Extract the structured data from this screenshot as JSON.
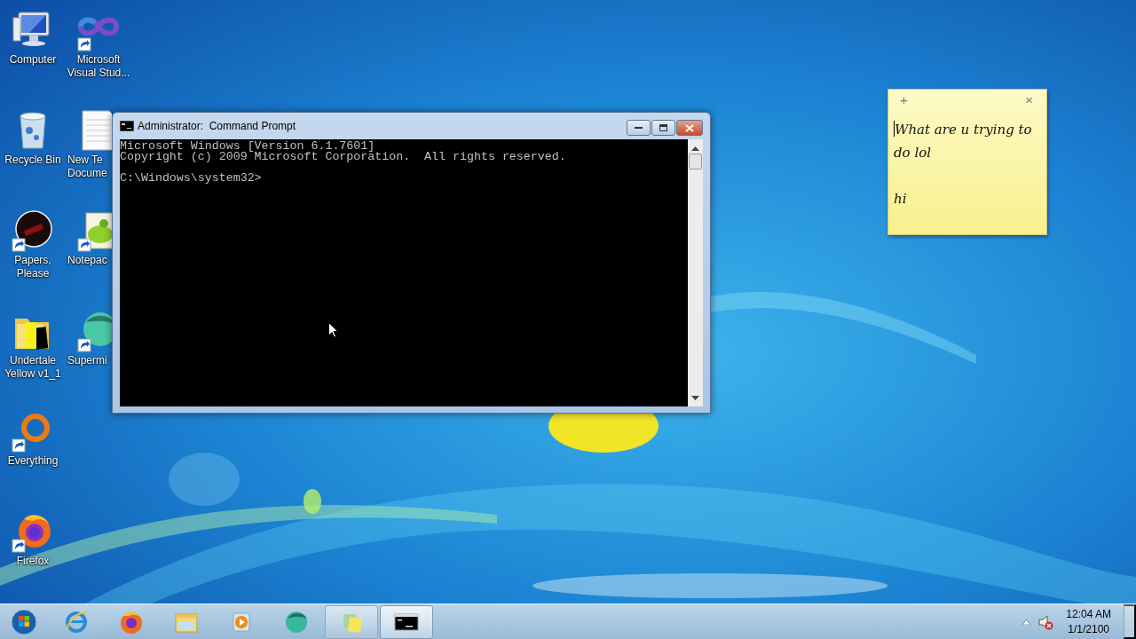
{
  "desktop_icon_columns": [
    [
      {
        "label": "Computer",
        "kind": "computer",
        "shortcut": false
      },
      {
        "label": "Recycle Bin",
        "kind": "bin",
        "shortcut": false
      },
      {
        "label": "Papers, Please",
        "kind": "dark-disc",
        "shortcut": true
      },
      {
        "label": "Undertale Yellow v1_1",
        "kind": "folder",
        "shortcut": false
      },
      {
        "label": "Everything",
        "kind": "ring",
        "shortcut": true
      },
      {
        "label": "Firefox",
        "kind": "firefox",
        "shortcut": true
      }
    ],
    [
      {
        "label": "Microsoft Visual Stud...",
        "kind": "infinity",
        "shortcut": true
      },
      {
        "label": "New Te Docume",
        "kind": "document",
        "shortcut": false
      },
      {
        "label": "Notepac",
        "kind": "notepad",
        "shortcut": true
      },
      {
        "label": "Supermi",
        "kind": "sphere",
        "shortcut": true
      }
    ]
  ],
  "window": {
    "title": "Administrator:  Command Prompt",
    "console_blocks": [
      [
        "Microsoft Windows [Version 6.1.7601]",
        "Copyright (c) 2009 Microsoft Corporation.  All rights reserved."
      ],
      [
        "C:\\Windows\\system32>"
      ]
    ]
  },
  "sticky_note": {
    "add": "+",
    "close": "×",
    "paragraphs": [
      "What are u trying to do lol",
      "hi"
    ]
  },
  "taskbar": {
    "items": [
      {
        "kind": "start",
        "running": false,
        "active": false
      },
      {
        "kind": "ie",
        "running": false,
        "active": false
      },
      {
        "kind": "firefox",
        "running": false,
        "active": false
      },
      {
        "kind": "explorer",
        "running": false,
        "active": false
      },
      {
        "kind": "media",
        "running": false,
        "active": false
      },
      {
        "kind": "sphere",
        "running": false,
        "active": false
      },
      {
        "kind": "sticky",
        "running": true,
        "active": false
      },
      {
        "kind": "cmd",
        "running": true,
        "active": true
      }
    ],
    "volume_muted": true,
    "time": "12:04 AM",
    "date": "1/1/2100"
  }
}
